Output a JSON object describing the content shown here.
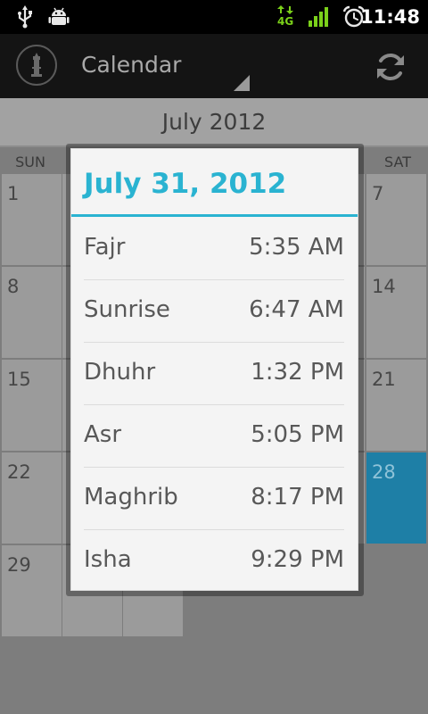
{
  "status_bar": {
    "time": "11:48",
    "network_label": "4G",
    "icons": [
      "usb-icon",
      "android-debug-icon",
      "network-4g-icon",
      "signal-icon",
      "alarm-icon"
    ]
  },
  "action_bar": {
    "title": "Calendar",
    "icons": [
      "app-logo-icon",
      "dropdown-triangle-icon",
      "refresh-icon"
    ]
  },
  "calendar": {
    "month": "July 2012",
    "weekdays": [
      "SUN",
      "SAT"
    ],
    "visible_days": [
      "1",
      "7",
      "8",
      "14",
      "15",
      "21",
      "22",
      "28",
      "29"
    ],
    "highlighted_day": "28"
  },
  "dialog": {
    "title": "July 31, 2012",
    "prayers": [
      {
        "name": "Fajr",
        "time": "5:35 AM"
      },
      {
        "name": "Sunrise",
        "time": "6:47 AM"
      },
      {
        "name": "Dhuhr",
        "time": "1:32 PM"
      },
      {
        "name": "Asr",
        "time": "5:05 PM"
      },
      {
        "name": "Maghrib",
        "time": "8:17 PM"
      },
      {
        "name": "Isha",
        "time": "9:29 PM"
      }
    ]
  },
  "colors": {
    "accent": "#2ab3d1",
    "highlight_cell": "#1e7fa6",
    "status_green": "#7bd11a"
  }
}
